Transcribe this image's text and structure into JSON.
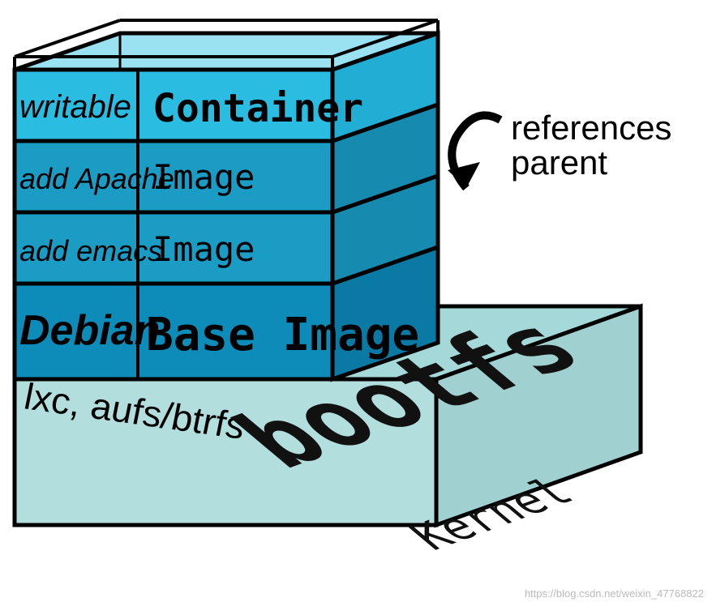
{
  "layers": {
    "container": {
      "left_label": "writable",
      "main_label": "Container"
    },
    "apache": {
      "left_label": "add Apache",
      "main_label": "Image"
    },
    "emacs": {
      "left_label": "add emacs",
      "main_label": "Image"
    },
    "base": {
      "left_label": "Debian",
      "main_label": "Base Image"
    },
    "kernel": {
      "left_label": "lxc, aufs/btrfs",
      "main_label": "bootfs",
      "sub_label": "Kernel"
    }
  },
  "annotation": {
    "line1": "references",
    "line2": "parent"
  },
  "colors": {
    "container_top": "#36c5e6",
    "container_face": "#2bbce2",
    "image_face": "#1a9cc5",
    "base_face": "#0d8cb9",
    "kernel_top": "#a5d8d8",
    "kernel_face": "#b3dede",
    "stroke": "#000000"
  },
  "watermark": "https://blog.csdn.net/weixin_47768822"
}
